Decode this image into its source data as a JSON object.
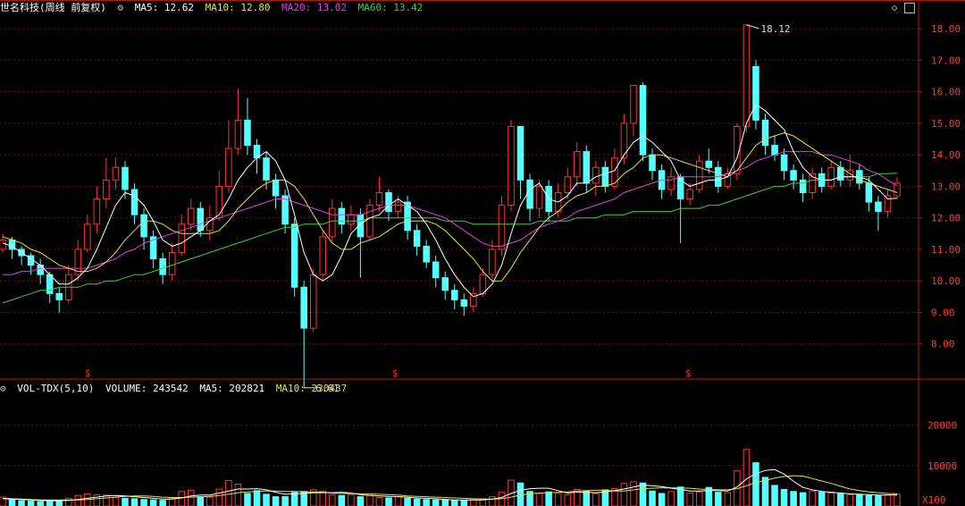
{
  "title": "世名科技(周线 前复权)",
  "ma": [
    {
      "label": "MA5: 12.62",
      "color": "#ffffff"
    },
    {
      "label": "MA10: 12.80",
      "color": "#e8e03c"
    },
    {
      "label": "MA20: 13.02",
      "color": "#e040e0"
    },
    {
      "label": "MA60: 13.42",
      "color": "#3cd23c"
    }
  ],
  "volume_header": {
    "name": "VOL-TDX(5,10)",
    "volume": "VOLUME: 243542",
    "ma5": "MA5: 202821",
    "ma10": "MA10: 230437"
  },
  "price_axis_labels": [
    "18.00",
    "17.00",
    "16.00",
    "15.00",
    "14.00",
    "13.00",
    "12.00",
    "11.00",
    "10.00",
    "9.00",
    "8.00"
  ],
  "volume_axis_labels": [
    "20000",
    "10000"
  ],
  "volume_unit": "X100",
  "max_marker": "18.12",
  "min_marker": "6.61",
  "event_marker": "$",
  "colors": {
    "up": "#ff3232",
    "down": "#54ffff",
    "grid": "#7a1010",
    "axis_text": "#ff3c3c"
  },
  "icons": [
    "settings-icon",
    "diamond-icon",
    "window-icon"
  ],
  "chart_data": {
    "type": "candlestick",
    "y_range": [
      7.0,
      18.4
    ],
    "vol_range": [
      0,
      27000
    ],
    "candles": [
      [
        11.0,
        11.3,
        11.5,
        10.9
      ],
      [
        11.3,
        11.0,
        11.4,
        10.7
      ],
      [
        11.0,
        10.8,
        11.1,
        10.5
      ],
      [
        10.8,
        10.5,
        10.9,
        10.2
      ],
      [
        10.5,
        10.2,
        10.7,
        9.9
      ],
      [
        10.2,
        9.6,
        10.3,
        9.3
      ],
      [
        9.6,
        9.4,
        9.8,
        9.0
      ],
      [
        9.4,
        10.2,
        10.5,
        9.3
      ],
      [
        10.2,
        11.0,
        11.3,
        10.0
      ],
      [
        11.0,
        11.8,
        12.1,
        10.9
      ],
      [
        11.8,
        12.6,
        13.0,
        11.5
      ],
      [
        12.6,
        13.2,
        13.9,
        12.3
      ],
      [
        13.2,
        13.6,
        13.9,
        12.9
      ],
      [
        13.6,
        12.9,
        13.8,
        12.6
      ],
      [
        12.9,
        12.1,
        13.1,
        11.8
      ],
      [
        12.1,
        11.4,
        12.3,
        11.0
      ],
      [
        11.4,
        10.7,
        11.6,
        10.4
      ],
      [
        10.7,
        10.2,
        10.9,
        9.9
      ],
      [
        10.2,
        10.9,
        11.2,
        10.0
      ],
      [
        10.9,
        11.8,
        12.1,
        10.8
      ],
      [
        11.8,
        12.3,
        12.6,
        11.6
      ],
      [
        12.3,
        11.6,
        12.5,
        11.4
      ],
      [
        11.6,
        12.0,
        12.4,
        11.3
      ],
      [
        12.0,
        13.0,
        13.5,
        11.9
      ],
      [
        13.0,
        14.2,
        15.1,
        12.8
      ],
      [
        14.2,
        15.1,
        16.1,
        14.0
      ],
      [
        15.1,
        14.3,
        15.8,
        14.0
      ],
      [
        14.3,
        13.9,
        14.5,
        13.4
      ],
      [
        13.9,
        13.2,
        14.1,
        12.9
      ],
      [
        13.2,
        12.7,
        13.4,
        12.3
      ],
      [
        12.7,
        11.8,
        12.9,
        11.5
      ],
      [
        11.8,
        9.8,
        12.0,
        9.5
      ],
      [
        9.8,
        8.5,
        10.0,
        6.61
      ],
      [
        8.5,
        10.2,
        10.4,
        8.4
      ],
      [
        10.2,
        11.4,
        11.6,
        10.0
      ],
      [
        11.4,
        12.3,
        12.6,
        11.2
      ],
      [
        12.3,
        11.8,
        12.5,
        11.5
      ],
      [
        11.8,
        12.1,
        12.4,
        11.6
      ],
      [
        12.1,
        11.4,
        12.3,
        10.1
      ],
      [
        11.4,
        12.4,
        12.6,
        11.3
      ],
      [
        12.4,
        12.8,
        13.3,
        12.2
      ],
      [
        12.8,
        12.2,
        12.9,
        11.9
      ],
      [
        12.2,
        12.5,
        12.7,
        12.0
      ],
      [
        12.5,
        11.6,
        12.7,
        11.3
      ],
      [
        11.6,
        11.1,
        11.8,
        10.8
      ],
      [
        11.1,
        10.6,
        11.3,
        10.4
      ],
      [
        10.6,
        10.1,
        10.8,
        9.8
      ],
      [
        10.1,
        9.7,
        10.3,
        9.4
      ],
      [
        9.7,
        9.4,
        9.9,
        9.1
      ],
      [
        9.4,
        9.2,
        9.6,
        8.9
      ],
      [
        9.2,
        9.6,
        9.8,
        9.0
      ],
      [
        9.6,
        10.2,
        10.4,
        9.5
      ],
      [
        10.2,
        11.0,
        11.3,
        10.0
      ],
      [
        11.0,
        12.4,
        12.7,
        10.8
      ],
      [
        12.4,
        14.9,
        15.1,
        12.2
      ],
      [
        14.9,
        13.2,
        14.9,
        12.6
      ],
      [
        13.2,
        12.3,
        13.4,
        11.9
      ],
      [
        12.3,
        13.0,
        13.2,
        12.0
      ],
      [
        13.0,
        12.2,
        13.2,
        11.9
      ],
      [
        12.2,
        12.8,
        13.1,
        12.0
      ],
      [
        12.8,
        13.3,
        13.6,
        12.6
      ],
      [
        13.3,
        14.1,
        14.4,
        13.0
      ],
      [
        14.1,
        13.1,
        14.3,
        12.8
      ],
      [
        13.1,
        13.6,
        13.8,
        12.7
      ],
      [
        13.6,
        13.0,
        13.8,
        12.8
      ],
      [
        13.0,
        13.9,
        14.2,
        12.9
      ],
      [
        13.9,
        15.0,
        15.3,
        13.7
      ],
      [
        15.0,
        16.2,
        16.2,
        14.6
      ],
      [
        16.2,
        14.0,
        16.3,
        13.8
      ],
      [
        14.0,
        13.5,
        14.2,
        13.2
      ],
      [
        13.5,
        12.9,
        13.7,
        12.6
      ],
      [
        12.9,
        13.3,
        13.6,
        12.7
      ],
      [
        13.3,
        12.6,
        13.4,
        11.2
      ],
      [
        12.6,
        12.9,
        13.1,
        12.4
      ],
      [
        12.9,
        13.8,
        14.0,
        12.8
      ],
      [
        13.8,
        13.6,
        14.2,
        13.4
      ],
      [
        13.6,
        13.0,
        13.8,
        12.8
      ],
      [
        13.0,
        13.4,
        13.6,
        12.9
      ],
      [
        13.4,
        14.9,
        15.0,
        13.2
      ],
      [
        14.9,
        18.12,
        18.12,
        14.7
      ],
      [
        16.8,
        15.1,
        17.0,
        14.8
      ],
      [
        15.1,
        14.3,
        15.3,
        14.0
      ],
      [
        14.3,
        14.0,
        14.6,
        13.8
      ],
      [
        14.0,
        13.5,
        14.2,
        13.2
      ],
      [
        13.5,
        13.2,
        13.7,
        12.9
      ],
      [
        13.2,
        12.8,
        13.4,
        12.5
      ],
      [
        12.8,
        13.4,
        13.6,
        12.6
      ],
      [
        13.4,
        13.0,
        13.6,
        12.8
      ],
      [
        13.0,
        13.6,
        13.8,
        12.9
      ],
      [
        13.6,
        13.2,
        13.8,
        13.0
      ],
      [
        13.2,
        13.5,
        14.0,
        13.0
      ],
      [
        13.5,
        13.1,
        13.7,
        12.9
      ],
      [
        13.1,
        12.5,
        13.3,
        12.2
      ],
      [
        12.5,
        12.2,
        12.7,
        11.6
      ],
      [
        12.2,
        12.7,
        12.9,
        12.0
      ],
      [
        12.7,
        13.1,
        13.3,
        12.6
      ]
    ],
    "volumes": [
      2200,
      1600,
      1300,
      1200,
      1100,
      1400,
      1300,
      1900,
      2600,
      3000,
      2800,
      2700,
      2100,
      1900,
      1800,
      1600,
      1500,
      1400,
      2000,
      3600,
      3900,
      2300,
      2200,
      4200,
      6300,
      5400,
      3100,
      3800,
      2900,
      2300,
      2300,
      3400,
      3600,
      4000,
      3700,
      2800,
      2600,
      2800,
      2300,
      2700,
      2100,
      2000,
      2300,
      1900,
      1700,
      1600,
      1500,
      1600,
      1400,
      1300,
      1500,
      1800,
      2300,
      3400,
      6400,
      5700,
      3600,
      3100,
      3500,
      3100,
      2800,
      4100,
      3700,
      3100,
      4000,
      4300,
      5600,
      6000,
      5700,
      3700,
      3100,
      3600,
      4700,
      3200,
      3500,
      4600,
      3400,
      3300,
      8700,
      14000,
      10700,
      7100,
      5100,
      4100,
      3600,
      3300,
      3700,
      3400,
      3200,
      3000,
      2800,
      2800,
      2600,
      2500,
      2800,
      2900
    ],
    "ma5": [
      11.2,
      11.1,
      10.9,
      10.7,
      10.5,
      10.2,
      9.9,
      9.9,
      10.1,
      10.4,
      11.0,
      11.7,
      12.4,
      12.8,
      12.7,
      12.4,
      11.9,
      11.3,
      11.1,
      11.2,
      11.4,
      11.6,
      11.9,
      12.1,
      12.6,
      13.2,
      13.6,
      13.9,
      14.1,
      13.8,
      13.2,
      12.1,
      10.9,
      10.2,
      10.0,
      10.2,
      10.8,
      11.5,
      11.8,
      12.0,
      12.1,
      12.4,
      12.6,
      12.4,
      12.2,
      11.8,
      11.3,
      10.7,
      10.2,
      9.8,
      9.5,
      9.6,
      9.9,
      10.5,
      11.5,
      12.4,
      12.9,
      13.1,
      12.6,
      12.5,
      12.7,
      13.1,
      13.1,
      13.3,
      13.4,
      13.5,
      14.0,
      14.4,
      14.6,
      14.4,
      14.1,
      13.8,
      13.2,
      13.0,
      13.1,
      13.2,
      13.2,
      13.3,
      13.9,
      15.0,
      15.6,
      15.4,
      15.1,
      14.8,
      14.1,
      13.6,
      13.3,
      13.2,
      13.2,
      13.3,
      13.3,
      13.3,
      13.2,
      12.9,
      12.6,
      12.62
    ],
    "ma10": [
      11.4,
      11.3,
      11.2,
      11.0,
      10.9,
      10.7,
      10.5,
      10.4,
      10.3,
      10.3,
      10.4,
      10.6,
      10.9,
      11.3,
      11.6,
      11.9,
      11.9,
      11.8,
      11.6,
      11.5,
      11.5,
      11.5,
      11.5,
      11.6,
      11.9,
      12.3,
      12.6,
      12.9,
      13.1,
      13.2,
      13.2,
      13.0,
      12.6,
      12.1,
      11.6,
      11.2,
      11.0,
      11.0,
      11.2,
      11.3,
      11.4,
      11.6,
      11.8,
      11.9,
      11.9,
      11.9,
      11.8,
      11.6,
      11.3,
      11.0,
      10.7,
      10.3,
      10.0,
      10.0,
      10.4,
      10.9,
      11.3,
      11.7,
      12.0,
      12.2,
      12.5,
      12.7,
      12.8,
      13.0,
      13.0,
      13.1,
      13.4,
      13.6,
      13.9,
      14.0,
      14.0,
      13.9,
      13.8,
      13.7,
      13.6,
      13.5,
      13.4,
      13.3,
      13.5,
      13.9,
      14.3,
      14.5,
      14.6,
      14.7,
      14.6,
      14.4,
      14.2,
      14.0,
      13.8,
      13.6,
      13.4,
      13.2,
      13.1,
      13.0,
      12.9,
      12.8
    ],
    "ma20": [
      10.2,
      10.2,
      10.3,
      10.3,
      10.4,
      10.4,
      10.4,
      10.4,
      10.4,
      10.4,
      10.5,
      10.6,
      10.7,
      10.9,
      11.0,
      11.2,
      11.3,
      11.4,
      11.5,
      11.6,
      11.7,
      11.8,
      11.9,
      12.0,
      12.1,
      12.2,
      12.3,
      12.4,
      12.5,
      12.6,
      12.6,
      12.5,
      12.4,
      12.3,
      12.2,
      12.1,
      12.1,
      12.1,
      12.1,
      12.2,
      12.3,
      12.4,
      12.4,
      12.4,
      12.3,
      12.2,
      12.1,
      12.0,
      11.8,
      11.6,
      11.4,
      11.2,
      11.1,
      11.1,
      11.2,
      11.3,
      11.5,
      11.7,
      11.8,
      11.9,
      12.0,
      12.2,
      12.3,
      12.4,
      12.5,
      12.6,
      12.8,
      12.9,
      13.0,
      13.1,
      13.2,
      13.2,
      13.3,
      13.3,
      13.3,
      13.3,
      13.3,
      13.4,
      13.5,
      13.6,
      13.8,
      13.9,
      14.0,
      14.1,
      14.1,
      14.1,
      14.1,
      14.0,
      14.0,
      13.9,
      13.8,
      13.7,
      13.5,
      13.4,
      13.2,
      13.02
    ],
    "ma60": [
      9.3,
      9.4,
      9.5,
      9.6,
      9.7,
      9.7,
      9.8,
      9.8,
      9.8,
      9.9,
      9.9,
      10.0,
      10.0,
      10.1,
      10.2,
      10.2,
      10.3,
      10.4,
      10.5,
      10.6,
      10.7,
      10.8,
      10.9,
      11.0,
      11.1,
      11.2,
      11.3,
      11.4,
      11.5,
      11.6,
      11.7,
      11.7,
      11.8,
      11.8,
      11.8,
      11.9,
      11.9,
      11.9,
      11.9,
      12.0,
      12.0,
      12.0,
      12.0,
      12.0,
      12.0,
      12.0,
      12.0,
      11.9,
      11.9,
      11.9,
      11.8,
      11.8,
      11.8,
      11.8,
      11.8,
      11.8,
      11.8,
      11.9,
      11.9,
      11.9,
      11.9,
      12.0,
      12.0,
      12.0,
      12.1,
      12.1,
      12.1,
      12.2,
      12.2,
      12.2,
      12.2,
      12.2,
      12.3,
      12.3,
      12.3,
      12.4,
      12.4,
      12.5,
      12.6,
      12.7,
      12.8,
      12.9,
      13.0,
      13.0,
      13.1,
      13.1,
      13.2,
      13.2,
      13.2,
      13.3,
      13.3,
      13.3,
      13.3,
      13.4,
      13.4,
      13.42
    ],
    "vol_ma5": [
      1800,
      1700,
      1600,
      1500,
      1400,
      1300,
      1300,
      1400,
      1600,
      1900,
      2200,
      2500,
      2600,
      2500,
      2300,
      2100,
      1900,
      1700,
      1700,
      2000,
      2500,
      2700,
      2700,
      3200,
      3700,
      4200,
      4200,
      4300,
      4000,
      3400,
      2900,
      3000,
      3100,
      3300,
      3300,
      3300,
      3400,
      3200,
      2800,
      2600,
      2500,
      2400,
      2300,
      2200,
      2000,
      1900,
      1800,
      1600,
      1500,
      1500,
      1500,
      1500,
      1700,
      2100,
      3100,
      3900,
      4300,
      4400,
      4400,
      3800,
      3200,
      3400,
      3400,
      3300,
      3500,
      3800,
      4200,
      4700,
      5200,
      5000,
      4800,
      4400,
      4100,
      3700,
      3700,
      3800,
      3800,
      3700,
      4700,
      6700,
      8000,
      8800,
      9000,
      7900,
      6100,
      4600,
      4000,
      3600,
      3400,
      3200,
      3000,
      2900,
      2800,
      2700,
      2700,
      2700
    ],
    "vol_ma10": [
      1900,
      1800,
      1700,
      1600,
      1500,
      1500,
      1500,
      1500,
      1500,
      1600,
      1800,
      2000,
      2200,
      2400,
      2500,
      2500,
      2400,
      2200,
      2100,
      2100,
      2200,
      2300,
      2400,
      2600,
      2900,
      3300,
      3500,
      3600,
      3700,
      3700,
      3600,
      3600,
      3500,
      3500,
      3400,
      3200,
      3100,
      3100,
      3000,
      3000,
      2900,
      2800,
      2700,
      2500,
      2400,
      2300,
      2200,
      2100,
      2000,
      1900,
      1800,
      1700,
      1700,
      1800,
      2200,
      2700,
      3000,
      3200,
      3300,
      3400,
      3500,
      3700,
      3800,
      3900,
      3900,
      3700,
      3700,
      4000,
      4300,
      4400,
      4500,
      4500,
      4500,
      4400,
      4200,
      4100,
      4000,
      4000,
      4300,
      5000,
      5800,
      6300,
      6900,
      7300,
      7500,
      7400,
      6800,
      6200,
      5600,
      4900,
      4200,
      3800,
      3500,
      3300,
      3100,
      3000
    ]
  }
}
